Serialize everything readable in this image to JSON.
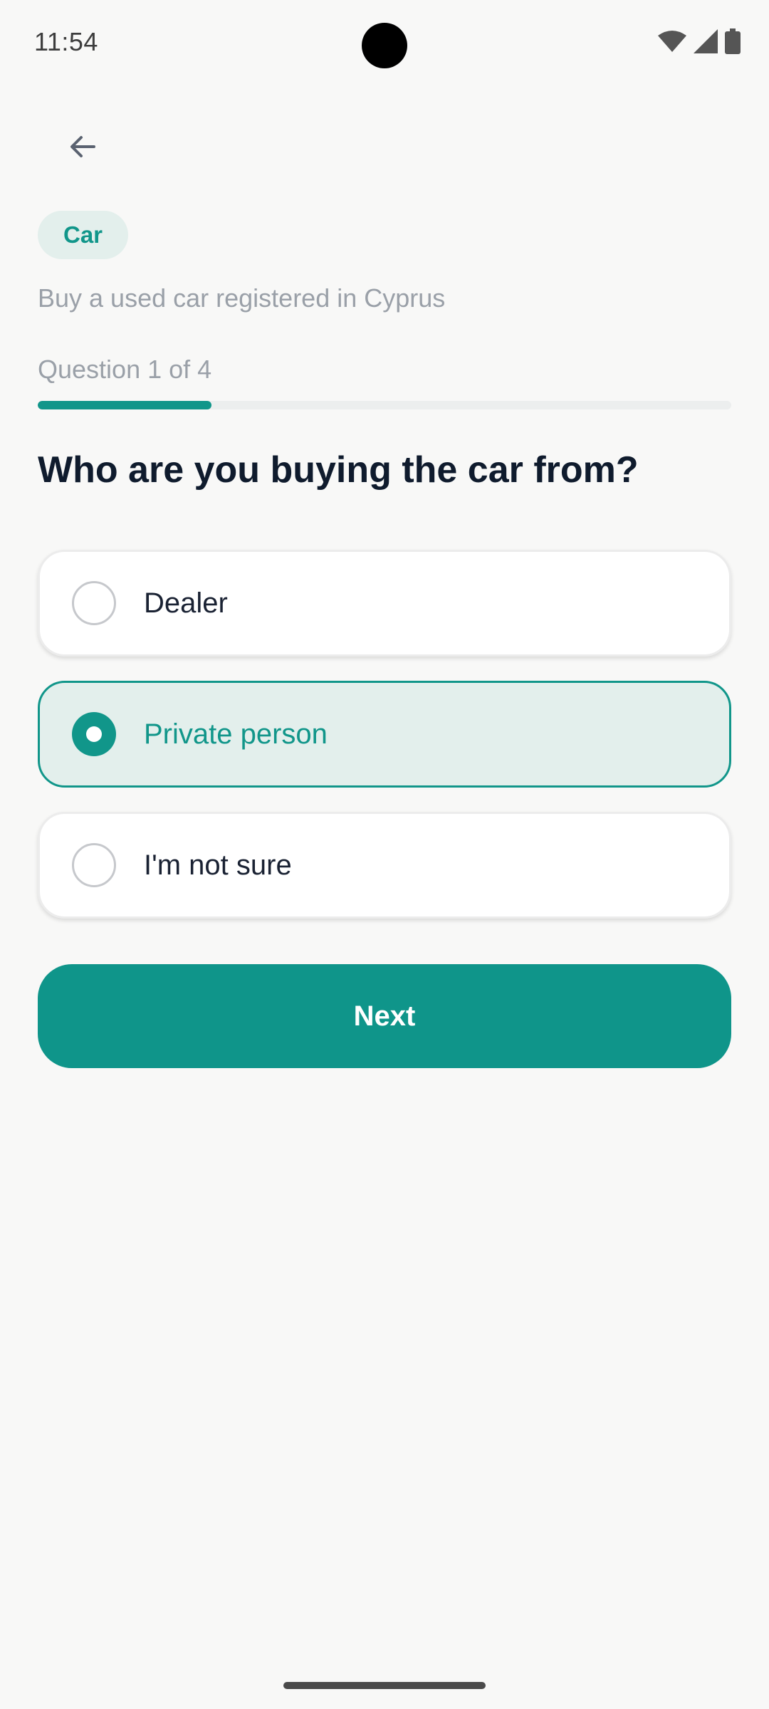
{
  "status_bar": {
    "time": "11:54",
    "icons": [
      "wifi-icon",
      "cellular-signal-icon",
      "battery-icon"
    ]
  },
  "header": {
    "back_icon": "arrow-left-icon"
  },
  "category": {
    "label": "Car"
  },
  "service": {
    "subtitle": "Buy a used car registered in Cyprus"
  },
  "progress": {
    "label": "Question 1 of 4",
    "current": 1,
    "total": 4
  },
  "question": {
    "title": "Who are you buying the car from?",
    "options": [
      {
        "label": "Dealer",
        "selected": false
      },
      {
        "label": "Private person",
        "selected": true
      },
      {
        "label": "I'm not sure",
        "selected": false
      }
    ]
  },
  "actions": {
    "next_label": "Next"
  },
  "colors": {
    "accent": "#11968a",
    "accent_light": "#e3efec",
    "heading": "#0f1b2d",
    "muted": "#9aa0a8",
    "background": "#f8f8f7"
  }
}
